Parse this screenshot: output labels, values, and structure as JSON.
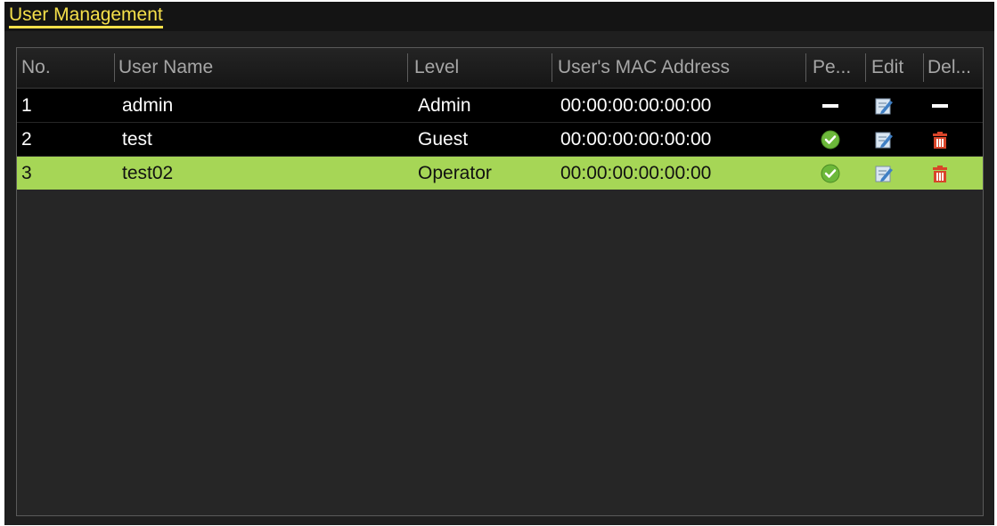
{
  "window": {
    "title": "User Management"
  },
  "table": {
    "columns": [
      "No.",
      "User Name",
      "Level",
      "User's MAC Address",
      "Pe...",
      "Edit",
      "Del..."
    ],
    "rows": [
      {
        "no": "1",
        "user_name": "admin",
        "level": "Admin",
        "mac": "00:00:00:00:00:00",
        "permission": "dash-icon",
        "edit": "edit-icon",
        "delete": "dash-icon"
      },
      {
        "no": "2",
        "user_name": "test",
        "level": "Guest",
        "mac": "00:00:00:00:00:00",
        "permission": "check-icon",
        "edit": "edit-icon",
        "delete": "trash-icon"
      },
      {
        "no": "3",
        "user_name": "test02",
        "level": "Operator",
        "mac": "00:00:00:00:00:00",
        "permission": "check-icon",
        "edit": "edit-icon",
        "delete": "trash-icon",
        "selected": true
      }
    ]
  },
  "colors": {
    "title": "#f5e04a",
    "selected_row": "#a6d656",
    "check": "#6cb83a",
    "trash": "#d8452a"
  }
}
